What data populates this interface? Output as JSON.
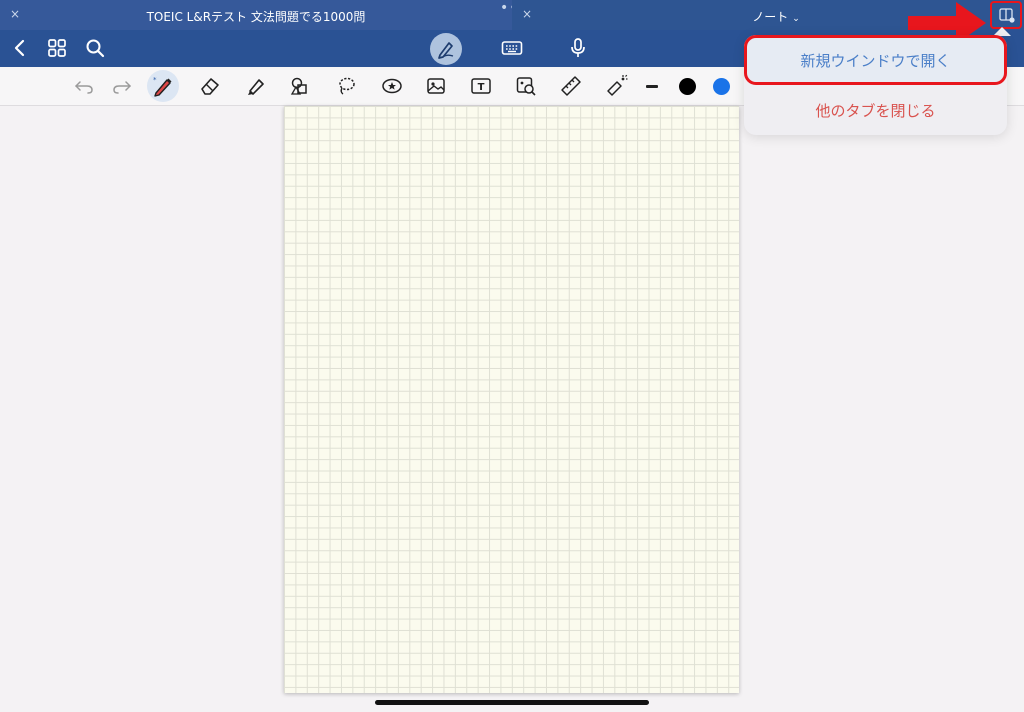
{
  "tabs": [
    {
      "title": "TOEIC L&Rテスト 文法問題でる1000問",
      "close": "×",
      "more": "•••"
    },
    {
      "title": "ノート",
      "close": "×",
      "chevron": "⌄"
    }
  ],
  "popover": {
    "items": [
      {
        "label": "新規ウインドウで開く"
      },
      {
        "label": "他のタブを閉じる"
      }
    ]
  },
  "colors": {
    "tabbar": "#2f568f",
    "navbar": "#2a5294",
    "highlight": "#e8161d",
    "ink_black": "#000000",
    "ink_blue": "#1a73e8"
  },
  "icons": [
    "back-icon",
    "grid-icon",
    "search-icon",
    "pen-mode-icon",
    "keyboard-icon",
    "microphone-icon",
    "undo-icon",
    "redo-icon",
    "pen-icon",
    "eraser-icon",
    "highlighter-icon",
    "shapes-icon",
    "lasso-icon",
    "sticker-icon",
    "image-icon",
    "text-box-icon",
    "image-search-icon",
    "ruler-icon",
    "laser-pointer-icon",
    "split-view-icon"
  ]
}
